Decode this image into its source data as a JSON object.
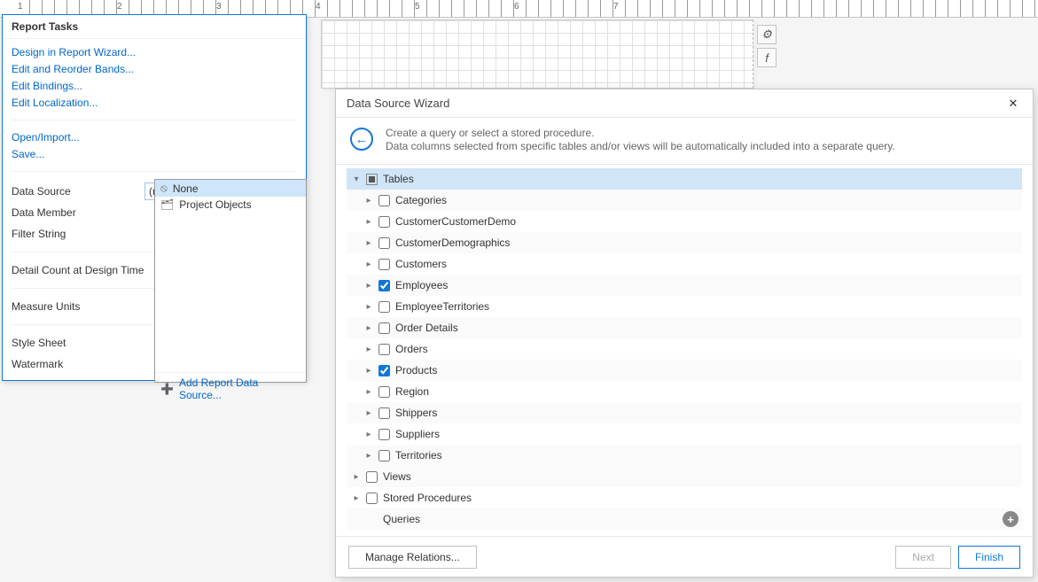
{
  "ruler_numbers": [
    "1",
    "2",
    "3",
    "4",
    "5",
    "6",
    "7"
  ],
  "toolbar_icons": {
    "gear": "⚙",
    "fx": "f"
  },
  "tasks": {
    "title": "Report Tasks",
    "links_group1": [
      "Design in Report Wizard...",
      "Edit and Reorder Bands...",
      "Edit Bindings...",
      "Edit Localization..."
    ],
    "links_group2": [
      "Open/Import...",
      "Save..."
    ],
    "props": {
      "data_source": "Data Source",
      "data_source_value": "(none)",
      "data_member": "Data Member",
      "filter_string": "Filter String",
      "detail_count": "Detail Count at Design Time",
      "measure_units": "Measure Units",
      "style_sheet": "Style Sheet",
      "watermark": "Watermark"
    }
  },
  "ds_dropdown": {
    "items": [
      {
        "icon": "⦸",
        "label": "None",
        "selected": true
      },
      {
        "icon": "🗂",
        "label": "Project Objects",
        "selected": false
      }
    ],
    "add_label": "Add Report Data Source..."
  },
  "wizard": {
    "title": "Data Source Wizard",
    "close_glyph": "✕",
    "back_glyph": "←",
    "header_line1": "Create a query or select a stored procedure.",
    "header_line2": "Data columns selected from specific tables and/or views will be automatically included into a separate query.",
    "tree": {
      "root": {
        "label": "Tables",
        "expanded": true,
        "tristate": true
      },
      "tables": [
        {
          "label": "Categories",
          "checked": false
        },
        {
          "label": "CustomerCustomerDemo",
          "checked": false
        },
        {
          "label": "CustomerDemographics",
          "checked": false
        },
        {
          "label": "Customers",
          "checked": false
        },
        {
          "label": "Employees",
          "checked": true
        },
        {
          "label": "EmployeeTerritories",
          "checked": false
        },
        {
          "label": "Order Details",
          "checked": false
        },
        {
          "label": "Orders",
          "checked": false
        },
        {
          "label": "Products",
          "checked": true
        },
        {
          "label": "Region",
          "checked": false
        },
        {
          "label": "Shippers",
          "checked": false
        },
        {
          "label": "Suppliers",
          "checked": false
        },
        {
          "label": "Territories",
          "checked": false
        }
      ],
      "groups_after": [
        {
          "label": "Views",
          "has_caret": true,
          "has_check": true
        },
        {
          "label": "Stored Procedures",
          "has_caret": true,
          "has_check": true
        },
        {
          "label": "Queries",
          "has_caret": false,
          "has_check": false,
          "has_plus": true
        }
      ]
    },
    "footer": {
      "manage": "Manage Relations...",
      "next": "Next",
      "finish": "Finish"
    }
  }
}
